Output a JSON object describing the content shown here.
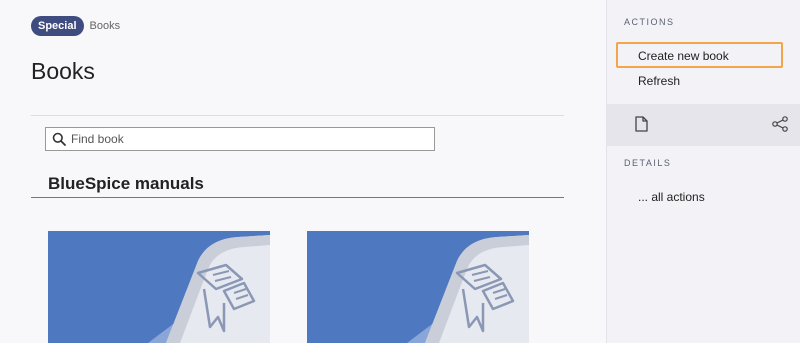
{
  "breadcrumb": {
    "namespace": "Special",
    "page": "Books"
  },
  "page": {
    "title": "Books"
  },
  "search": {
    "placeholder": "Find book"
  },
  "section": {
    "heading": "BlueSpice manuals"
  },
  "books": [
    {
      "icon": "book-cover-image"
    },
    {
      "icon": "book-cover-image"
    }
  ],
  "sidebar": {
    "actions_label": "ACTIONS",
    "create_label": "Create new book",
    "refresh_label": "Refresh",
    "details_label": "DETAILS",
    "all_actions_label": "... all actions",
    "tool_icons": [
      "page-icon",
      "share-icon"
    ]
  },
  "colors": {
    "accent": "#3e4c7f",
    "highlight": "#f2a54a",
    "cover_blue": "#4e79c1"
  }
}
